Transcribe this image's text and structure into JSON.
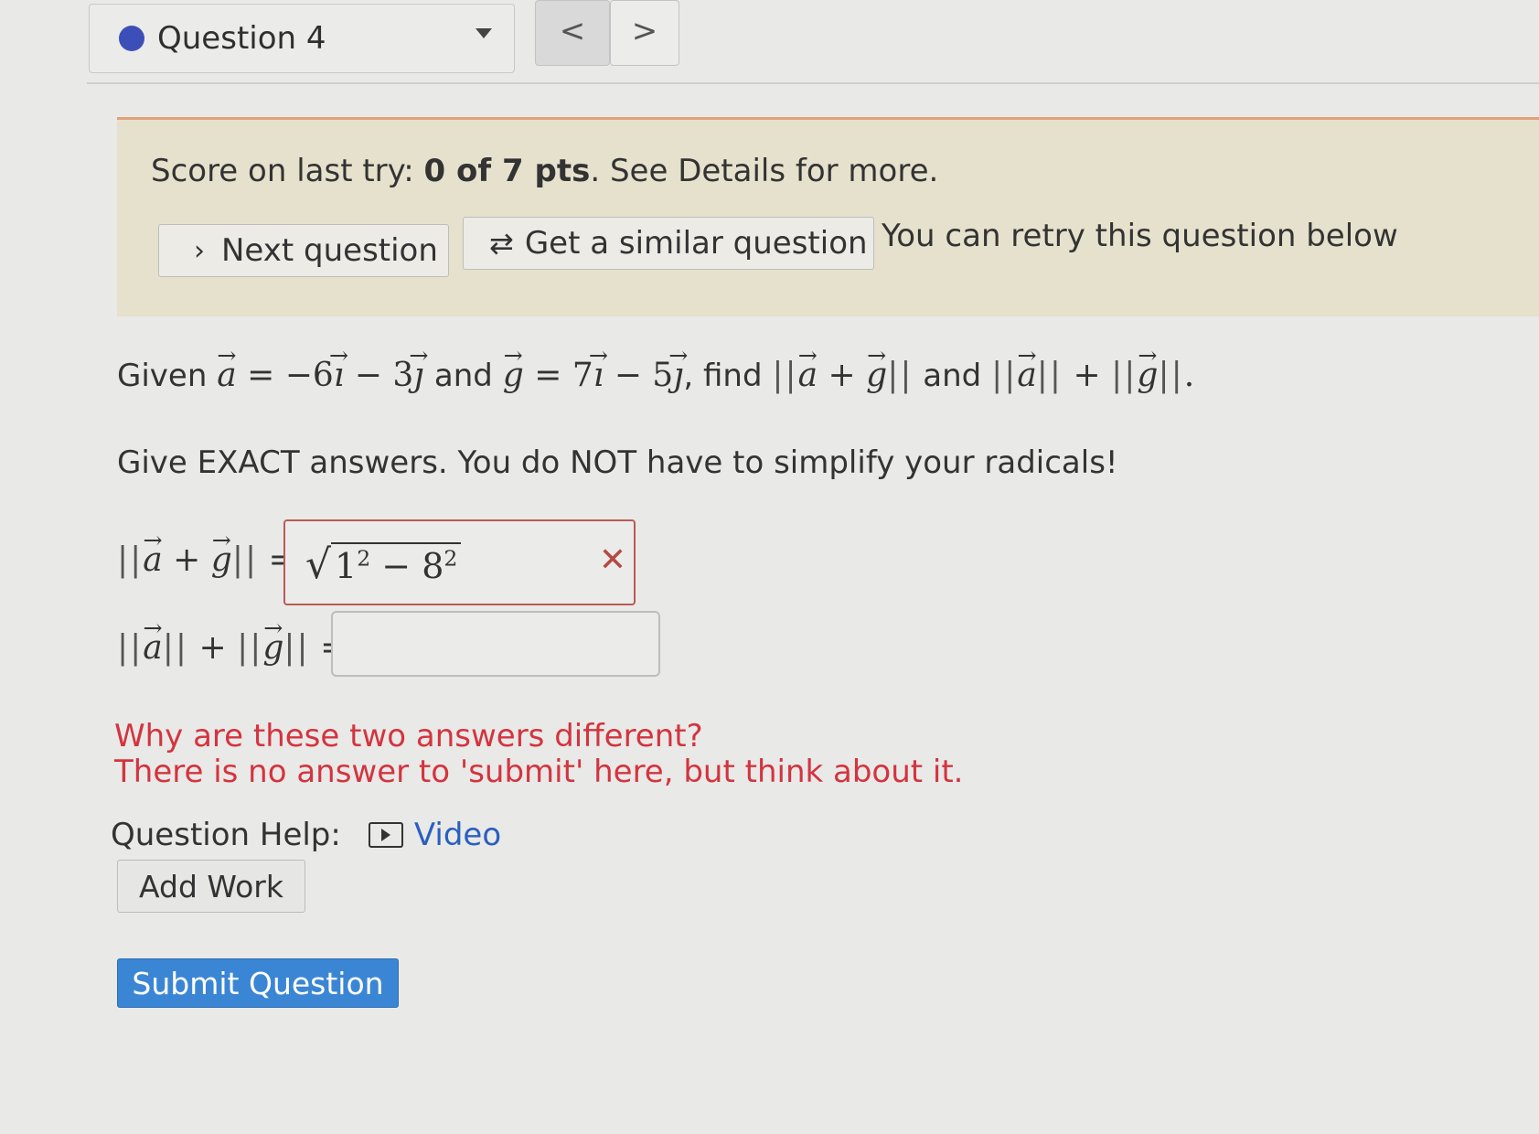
{
  "header": {
    "question_label": "Question 4",
    "prev_glyph": "<",
    "next_glyph": ">"
  },
  "banner": {
    "score_prefix": "Score on last try: ",
    "score_value": "0 of 7 pts",
    "score_suffix": ". See Details for more.",
    "next_question_label": "Next question",
    "similar_question_label": "Get a similar question",
    "retry_text": "You can retry this question below"
  },
  "question": {
    "given_word": "Given",
    "and_word": "and",
    "find_word": ", find",
    "and_word2": "and",
    "a_expr": "−6",
    "a_expr2": "− 3",
    "g_expr": "7",
    "g_expr2": "− 5",
    "instructions": "Give EXACT answers. You do NOT have to simplify your radicals!"
  },
  "answers": {
    "answer1_base1": "1",
    "answer1_exp1": "2",
    "answer1_minus": " − ",
    "answer1_base2": "8",
    "answer1_exp2": "2",
    "answer2_value": "",
    "incorrect_mark": "✕"
  },
  "note": {
    "line1": "Why are these two answers different?",
    "line2": "There is no answer to 'submit' here, but think about it."
  },
  "help": {
    "label": "Question Help:",
    "video_label": "Video",
    "add_work_label": "Add Work",
    "submit_label": "Submit Question"
  },
  "colors": {
    "accent_blue": "#3b86d4",
    "error_red": "#d3343f",
    "banner_bg": "#e6e1cc",
    "question_dot": "#3c4fb8"
  }
}
